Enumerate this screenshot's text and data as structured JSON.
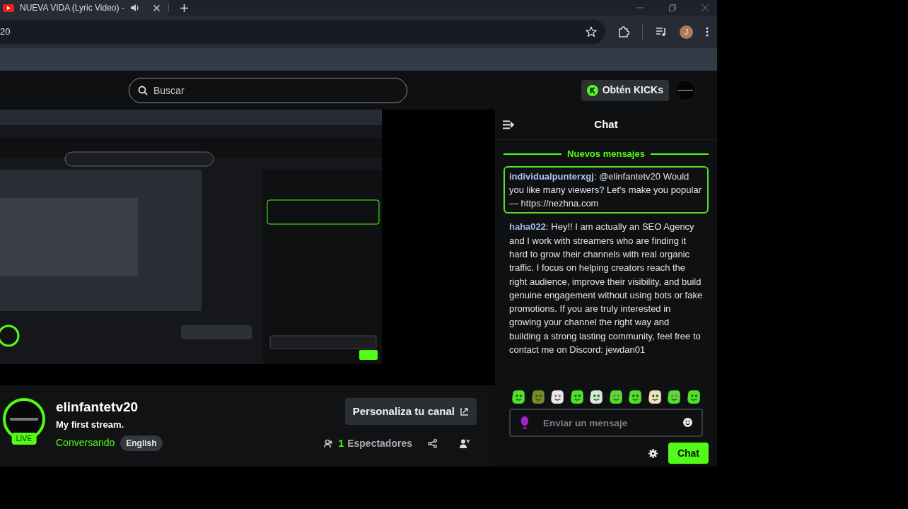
{
  "browser": {
    "tab": {
      "title": "NUEVA VIDA (Lyric Video) -"
    },
    "address": {
      "url": "20"
    },
    "profile": "J"
  },
  "header": {
    "search": {
      "placeholder": "Buscar"
    },
    "kicks_button": "Obtén KICKs"
  },
  "channel": {
    "name": "elinfantetv20",
    "stream_title": "My first stream.",
    "live_badge": "LIVE",
    "category": "Conversando",
    "language": "English",
    "customize_button": "Personaliza tu canal",
    "viewer_count": "1",
    "viewer_label": "Espectadores"
  },
  "chat": {
    "title": "Chat",
    "new_messages_label": "Nuevos mensajes",
    "messages": [
      {
        "user": "individualpunterxgj",
        "separator": ":",
        "color": "#a9c6f2",
        "text": "@elinfantetv20 Would you like many viewers? Let's make you popular — https://nezhna.com",
        "highlighted": true
      },
      {
        "user": "haha022",
        "separator": ":",
        "color": "#9db8ec",
        "text": "Hey!! I am actually an SEO Agency and I work with streamers who are finding it hard to grow their channels with real organic traffic. I focus on helping creators reach the right audience, improve their visibility, and build genuine engagement without using bots or fake promotions. If you are truly interested in growing your channel the right way and building a strong lasting community, feel free to contact me on Discord: jewdan01",
        "highlighted": false
      }
    ],
    "input": {
      "placeholder": "Enviar un mensaje"
    },
    "send_button": "Chat"
  }
}
